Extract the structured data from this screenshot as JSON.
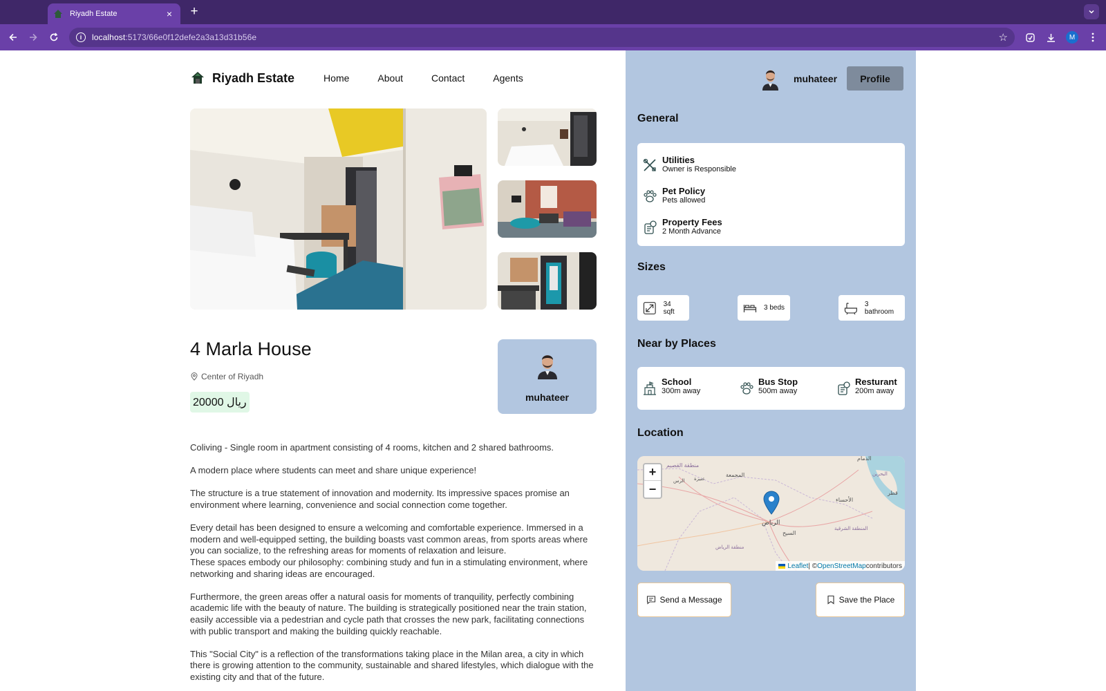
{
  "browser": {
    "tab_title": "Riyadh Estate",
    "tab_close": "×",
    "new_tab": "+",
    "url_host": "localhost",
    "url_path": ":5173/66e0f12defe2a3a13d31b56e",
    "profile_initial": "M",
    "accent": "#6a40a8"
  },
  "nav": {
    "brand": "Riyadh Estate",
    "links": [
      "Home",
      "About",
      "Contact",
      "Agents"
    ]
  },
  "listing": {
    "title": "4 Marla House",
    "address": "Center of Riyadh",
    "price": "20000 ريال",
    "agent_name": "muhateer",
    "description": [
      "Coliving - Single room in apartment consisting of 4 rooms, kitchen and 2 shared bathrooms.",
      "A modern place where students can meet and share unique experience!",
      "The structure is a true statement of innovation and modernity. Its impressive spaces promise an environment where learning, convenience and social connection come together.",
      "Every detail has been designed to ensure a welcoming and comfortable experience. Immersed in a modern and well-equipped setting, the building boasts vast common areas, from sports areas where you can socialize, to the refreshing areas for moments of relaxation and leisure.",
      "These spaces embody our philosophy: combining study and fun in a stimulating environment, where networking and sharing ideas are encouraged.",
      "Furthermore, the green areas offer a natural oasis for moments of tranquility, perfectly combining academic life with the beauty of nature. The building is strategically positioned near the train station, easily accessible via a pedestrian and cycle path that crosses the new park, facilitating connections with public transport and making the building quickly reachable.",
      "This \"Social City\" is a reflection of the transformations taking place in the Milan area, a city in which there is growing attention to the community, sustainable and shared lifestyles, which dialogue with the existing city and that of the future."
    ]
  },
  "user": {
    "name": "muhateer",
    "profile_button": "Profile"
  },
  "general": {
    "title": "General",
    "items": [
      {
        "label": "Utilities",
        "value": "Owner is Responsible",
        "icon": "tools-icon"
      },
      {
        "label": "Pet Policy",
        "value": "Pets allowed",
        "icon": "paw-icon"
      },
      {
        "label": "Property Fees",
        "value": "2 Month Advance",
        "icon": "fee-icon"
      }
    ]
  },
  "sizes": {
    "title": "Sizes",
    "items": [
      {
        "value": "34 sqft",
        "icon": "expand-icon"
      },
      {
        "value": "3 beds",
        "icon": "bed-icon"
      },
      {
        "value": "3 bathroom",
        "icon": "bath-icon"
      }
    ]
  },
  "nearby": {
    "title": "Near by Places",
    "items": [
      {
        "label": "School",
        "value": "300m away",
        "icon": "school-icon"
      },
      {
        "label": "Bus Stop",
        "value": "500m away",
        "icon": "bus-icon"
      },
      {
        "label": "Resturant",
        "value": "200m away",
        "icon": "restaurant-icon"
      }
    ]
  },
  "location": {
    "title": "Location",
    "zoom_in": "+",
    "zoom_out": "−",
    "attribution_leaflet": "Leaflet",
    "attribution_sep": " | © ",
    "attribution_osm": "OpenStreetMap",
    "attribution_tail": " contributors",
    "places": [
      "منطقة القصيم",
      "المجمعة",
      "عنيزة",
      "الرس",
      "الدمام",
      "البحرين",
      "قطر",
      "الأحساء",
      "الرياض",
      "السيح",
      "المنطقة الشرقية",
      "منطقة الرياض"
    ]
  },
  "actions": {
    "send_message": "Send a Message",
    "save_place": "Save the Place"
  }
}
